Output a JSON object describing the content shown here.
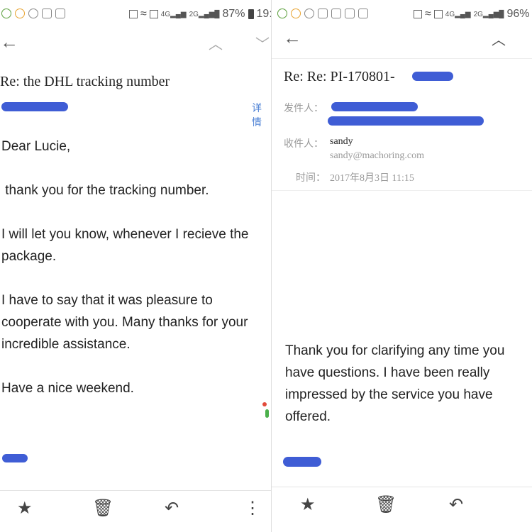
{
  "left": {
    "status": {
      "battery": "87%",
      "time": "19:1"
    },
    "subject": "Re: the DHL tracking number",
    "details_link": "详情",
    "body": [
      "Dear Lucie,",
      " thank you for the tracking number.",
      "I will let you know, whenever I recieve the package.",
      "I have to say that it was pleasure to cooperate with you. Many thanks for your incredible assistance.",
      "Have a nice weekend."
    ],
    "icons": {
      "back": "arrow-back-icon",
      "prev": "chevron-up-icon",
      "next": "chevron-down-icon"
    },
    "bottom": [
      "star-icon",
      "delete-icon",
      "reply-icon",
      "more-icon"
    ]
  },
  "right": {
    "status": {
      "battery": "96%"
    },
    "subject": "Re: Re: PI-170801-",
    "from_label": "发件人：",
    "to_label": "收件人：",
    "to_name": "sandy",
    "to_email": "sandy@machoring.com",
    "time_label": "时间：",
    "time_value": "2017年8月3日  11:15",
    "body": "Thank you for clarifying any time you have questions.  I have been really impressed by the service you have offered.",
    "bottom": [
      "star-icon",
      "delete-icon",
      "reply-icon",
      "more-icon"
    ]
  }
}
